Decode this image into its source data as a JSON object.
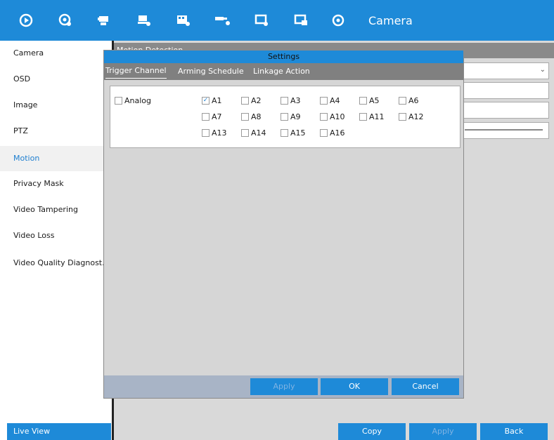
{
  "toolbar": {
    "title": "Camera",
    "icons": [
      "play-icon",
      "camera-settings-icon",
      "record-camera-icon",
      "alarm-icon",
      "video-settings-icon",
      "network-camera-icon",
      "system-monitor-icon",
      "maintenance-icon",
      "power-icon"
    ]
  },
  "sidebar": {
    "items": [
      {
        "label": "Camera"
      },
      {
        "label": "OSD"
      },
      {
        "label": "Image"
      },
      {
        "label": "PTZ"
      },
      {
        "label": "Motion"
      },
      {
        "label": "Privacy Mask"
      },
      {
        "label": "Video Tampering"
      },
      {
        "label": "Video Loss"
      },
      {
        "label": "Video Quality Diagnost..."
      }
    ],
    "active_index": 4,
    "live_view_label": "Live View"
  },
  "main": {
    "header": "Motion Detection",
    "copy_label": "Copy",
    "apply_label": "Apply",
    "back_label": "Back"
  },
  "dialog": {
    "title": "Settings",
    "tabs": [
      {
        "label": "Trigger Channel"
      },
      {
        "label": "Arming Schedule"
      },
      {
        "label": "Linkage Action"
      }
    ],
    "analog_label": "Analog",
    "channels": [
      {
        "label": "A1",
        "checked": true
      },
      {
        "label": "A2",
        "checked": false
      },
      {
        "label": "A3",
        "checked": false
      },
      {
        "label": "A4",
        "checked": false
      },
      {
        "label": "A5",
        "checked": false
      },
      {
        "label": "A6",
        "checked": false
      },
      {
        "label": "A7",
        "checked": false
      },
      {
        "label": "A8",
        "checked": false
      },
      {
        "label": "A9",
        "checked": false
      },
      {
        "label": "A10",
        "checked": false
      },
      {
        "label": "A11",
        "checked": false
      },
      {
        "label": "A12",
        "checked": false
      },
      {
        "label": "A13",
        "checked": false
      },
      {
        "label": "A14",
        "checked": false
      },
      {
        "label": "A15",
        "checked": false
      },
      {
        "label": "A16",
        "checked": false
      }
    ],
    "apply_label": "Apply",
    "ok_label": "OK",
    "cancel_label": "Cancel"
  },
  "colors": {
    "accent": "#1e8ad8",
    "active_text": "#1e7fd0",
    "tab_bar": "#808080",
    "footer": "#a8b4c6"
  }
}
